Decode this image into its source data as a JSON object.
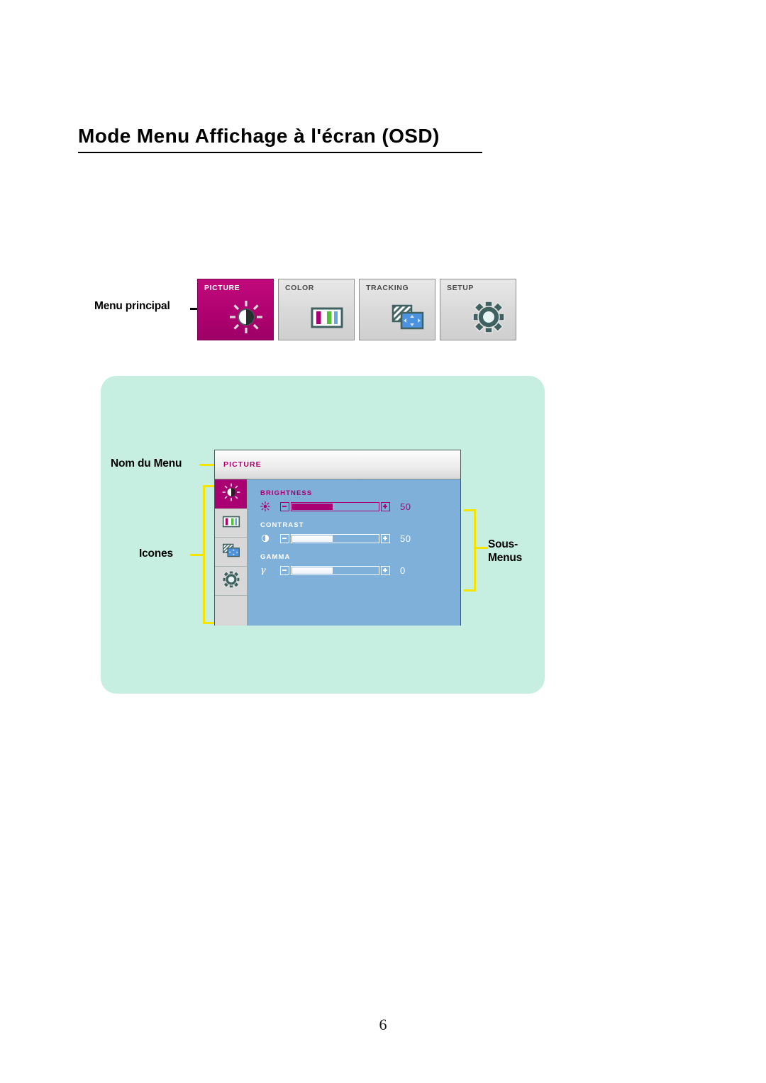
{
  "page": {
    "title": "Mode Menu Affichage à l'écran (OSD)",
    "number": "6"
  },
  "main_menu": {
    "label": "Menu principal",
    "tiles": [
      {
        "label": "PICTURE",
        "icon": "brightness-icon",
        "selected": true
      },
      {
        "label": "COLOR",
        "icon": "color-bars-icon",
        "selected": false
      },
      {
        "label": "TRACKING",
        "icon": "tracking-icon",
        "selected": false
      },
      {
        "label": "SETUP",
        "icon": "gear-icon",
        "selected": false
      }
    ]
  },
  "diagram": {
    "callouts": {
      "menu_name": "Nom du Menu",
      "icons": "Icones",
      "submenus": "Sous-\nMenus",
      "submenus_line1": "Sous-",
      "submenus_line2": "Menus"
    },
    "osd": {
      "title": "PICTURE",
      "sidebar_icons": [
        "brightness-icon",
        "color-bars-icon",
        "tracking-icon",
        "gear-icon",
        "empty-slot"
      ],
      "controls": [
        {
          "name": "BRIGHTNESS",
          "glyph": "sun-icon",
          "value": "50",
          "fill_percent": 46
        },
        {
          "name": "CONTRAST",
          "glyph": "contrast-icon",
          "value": "50",
          "fill_percent": 46
        },
        {
          "name": "GAMMA",
          "glyph": "gamma-symbol",
          "value": "0",
          "fill_percent": 46
        }
      ],
      "decrease_label": "−",
      "increase_label": "+"
    }
  },
  "colors": {
    "accent_magenta": "#a90072",
    "osd_blue": "#7fb0da",
    "panel_mint": "#c6efe2",
    "callout_yellow": "#f5e400"
  }
}
